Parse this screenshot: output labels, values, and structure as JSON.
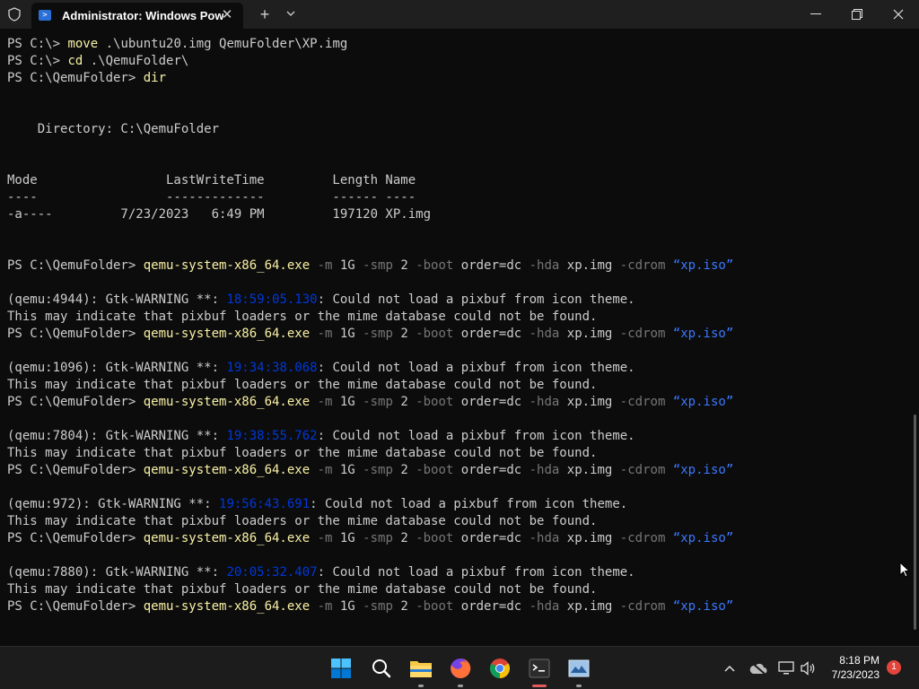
{
  "colors": {
    "bg": "#0c0c0c",
    "text": "#cccccc",
    "command": "#f9f1a5",
    "parameter": "#767676",
    "string": "#3b78ff",
    "timestamp": "#0037da"
  },
  "window": {
    "tab_title": "Administrator: Windows PowerShell"
  },
  "terminal": {
    "lines": [
      [
        {
          "t": "PS C:\\> ",
          "c": "text"
        },
        {
          "t": "move",
          "c": "command"
        },
        {
          "t": " .\\ubuntu20.img QemuFolder\\XP.img",
          "c": "text"
        }
      ],
      [
        {
          "t": "PS C:\\> ",
          "c": "text"
        },
        {
          "t": "cd",
          "c": "command"
        },
        {
          "t": " .\\QemuFolder\\",
          "c": "text"
        }
      ],
      [
        {
          "t": "PS C:\\QemuFolder> ",
          "c": "text"
        },
        {
          "t": "dir",
          "c": "command"
        }
      ],
      [],
      [],
      [
        {
          "t": "    Directory: C:\\QemuFolder",
          "c": "text"
        }
      ],
      [],
      [],
      [
        {
          "t": "Mode                 LastWriteTime         Length Name",
          "c": "text"
        }
      ],
      [
        {
          "t": "----                 -------------         ------ ----",
          "c": "text"
        }
      ],
      [
        {
          "t": "-a----         7/23/2023   6:49 PM         197120 XP.img",
          "c": "text"
        }
      ],
      [],
      [],
      [
        {
          "t": "PS C:\\QemuFolder> ",
          "c": "text"
        },
        {
          "t": "qemu-system-x86_64.exe",
          "c": "command"
        },
        {
          "t": " -m",
          "c": "parameter"
        },
        {
          "t": " 1G",
          "c": "text"
        },
        {
          "t": " -smp",
          "c": "parameter"
        },
        {
          "t": " 2",
          "c": "text"
        },
        {
          "t": " -boot",
          "c": "parameter"
        },
        {
          "t": " order=dc",
          "c": "text"
        },
        {
          "t": " -hda",
          "c": "parameter"
        },
        {
          "t": " xp.img",
          "c": "text"
        },
        {
          "t": " -cdrom",
          "c": "parameter"
        },
        {
          "t": " “xp.iso”",
          "c": "string"
        }
      ],
      [],
      [
        {
          "t": "(qemu:4944): Gtk-WARNING **: ",
          "c": "text"
        },
        {
          "t": "18:59:05.130",
          "c": "timestamp"
        },
        {
          "t": ": Could not load a pixbuf from icon theme.",
          "c": "text"
        }
      ],
      [
        {
          "t": "This may indicate that pixbuf loaders or the mime database could not be found.",
          "c": "text"
        }
      ],
      [
        {
          "t": "PS C:\\QemuFolder> ",
          "c": "text"
        },
        {
          "t": "qemu-system-x86_64.exe",
          "c": "command"
        },
        {
          "t": " -m",
          "c": "parameter"
        },
        {
          "t": " 1G",
          "c": "text"
        },
        {
          "t": " -smp",
          "c": "parameter"
        },
        {
          "t": " 2",
          "c": "text"
        },
        {
          "t": " -boot",
          "c": "parameter"
        },
        {
          "t": " order=dc",
          "c": "text"
        },
        {
          "t": " -hda",
          "c": "parameter"
        },
        {
          "t": " xp.img",
          "c": "text"
        },
        {
          "t": " -cdrom",
          "c": "parameter"
        },
        {
          "t": " “xp.iso”",
          "c": "string"
        }
      ],
      [],
      [
        {
          "t": "(qemu:1096): Gtk-WARNING **: ",
          "c": "text"
        },
        {
          "t": "19:34:38.068",
          "c": "timestamp"
        },
        {
          "t": ": Could not load a pixbuf from icon theme.",
          "c": "text"
        }
      ],
      [
        {
          "t": "This may indicate that pixbuf loaders or the mime database could not be found.",
          "c": "text"
        }
      ],
      [
        {
          "t": "PS C:\\QemuFolder> ",
          "c": "text"
        },
        {
          "t": "qemu-system-x86_64.exe",
          "c": "command"
        },
        {
          "t": " -m",
          "c": "parameter"
        },
        {
          "t": " 1G",
          "c": "text"
        },
        {
          "t": " -smp",
          "c": "parameter"
        },
        {
          "t": " 2",
          "c": "text"
        },
        {
          "t": " -boot",
          "c": "parameter"
        },
        {
          "t": " order=dc",
          "c": "text"
        },
        {
          "t": " -hda",
          "c": "parameter"
        },
        {
          "t": " xp.img",
          "c": "text"
        },
        {
          "t": " -cdrom",
          "c": "parameter"
        },
        {
          "t": " “xp.iso”",
          "c": "string"
        }
      ],
      [],
      [
        {
          "t": "(qemu:7804): Gtk-WARNING **: ",
          "c": "text"
        },
        {
          "t": "19:38:55.762",
          "c": "timestamp"
        },
        {
          "t": ": Could not load a pixbuf from icon theme.",
          "c": "text"
        }
      ],
      [
        {
          "t": "This may indicate that pixbuf loaders or the mime database could not be found.",
          "c": "text"
        }
      ],
      [
        {
          "t": "PS C:\\QemuFolder> ",
          "c": "text"
        },
        {
          "t": "qemu-system-x86_64.exe",
          "c": "command"
        },
        {
          "t": " -m",
          "c": "parameter"
        },
        {
          "t": " 1G",
          "c": "text"
        },
        {
          "t": " -smp",
          "c": "parameter"
        },
        {
          "t": " 2",
          "c": "text"
        },
        {
          "t": " -boot",
          "c": "parameter"
        },
        {
          "t": " order=dc",
          "c": "text"
        },
        {
          "t": " -hda",
          "c": "parameter"
        },
        {
          "t": " xp.img",
          "c": "text"
        },
        {
          "t": " -cdrom",
          "c": "parameter"
        },
        {
          "t": " “xp.iso”",
          "c": "string"
        }
      ],
      [],
      [
        {
          "t": "(qemu:972): Gtk-WARNING **: ",
          "c": "text"
        },
        {
          "t": "19:56:43.691",
          "c": "timestamp"
        },
        {
          "t": ": Could not load a pixbuf from icon theme.",
          "c": "text"
        }
      ],
      [
        {
          "t": "This may indicate that pixbuf loaders or the mime database could not be found.",
          "c": "text"
        }
      ],
      [
        {
          "t": "PS C:\\QemuFolder> ",
          "c": "text"
        },
        {
          "t": "qemu-system-x86_64.exe",
          "c": "command"
        },
        {
          "t": " -m",
          "c": "parameter"
        },
        {
          "t": " 1G",
          "c": "text"
        },
        {
          "t": " -smp",
          "c": "parameter"
        },
        {
          "t": " 2",
          "c": "text"
        },
        {
          "t": " -boot",
          "c": "parameter"
        },
        {
          "t": " order=dc",
          "c": "text"
        },
        {
          "t": " -hda",
          "c": "parameter"
        },
        {
          "t": " xp.img",
          "c": "text"
        },
        {
          "t": " -cdrom",
          "c": "parameter"
        },
        {
          "t": " “xp.iso”",
          "c": "string"
        }
      ],
      [],
      [
        {
          "t": "(qemu:7880): Gtk-WARNING **: ",
          "c": "text"
        },
        {
          "t": "20:05:32.407",
          "c": "timestamp"
        },
        {
          "t": ": Could not load a pixbuf from icon theme.",
          "c": "text"
        }
      ],
      [
        {
          "t": "This may indicate that pixbuf loaders or the mime database could not be found.",
          "c": "text"
        }
      ],
      [
        {
          "t": "PS C:\\QemuFolder> ",
          "c": "text"
        },
        {
          "t": "qemu-system-x86_64.exe",
          "c": "command"
        },
        {
          "t": " -m",
          "c": "parameter"
        },
        {
          "t": " 1G",
          "c": "text"
        },
        {
          "t": " -smp",
          "c": "parameter"
        },
        {
          "t": " 2",
          "c": "text"
        },
        {
          "t": " -boot",
          "c": "parameter"
        },
        {
          "t": " order=dc",
          "c": "text"
        },
        {
          "t": " -hda",
          "c": "parameter"
        },
        {
          "t": " xp.img",
          "c": "text"
        },
        {
          "t": " -cdrom",
          "c": "parameter"
        },
        {
          "t": " “xp.iso”",
          "c": "string"
        }
      ]
    ]
  },
  "taskbar": {
    "apps": [
      {
        "name": "start-button",
        "icon": "windows-logo-icon"
      },
      {
        "name": "search-button",
        "icon": "search-icon"
      },
      {
        "name": "file-explorer",
        "icon": "folder-icon"
      },
      {
        "name": "firefox",
        "icon": "firefox-icon"
      },
      {
        "name": "chrome",
        "icon": "chrome-icon"
      },
      {
        "name": "terminal",
        "icon": "terminal-icon"
      },
      {
        "name": "qemu-window",
        "icon": "qemu-icon"
      }
    ],
    "time": "8:18 PM",
    "date": "7/23/2023",
    "notification_count": "1"
  }
}
